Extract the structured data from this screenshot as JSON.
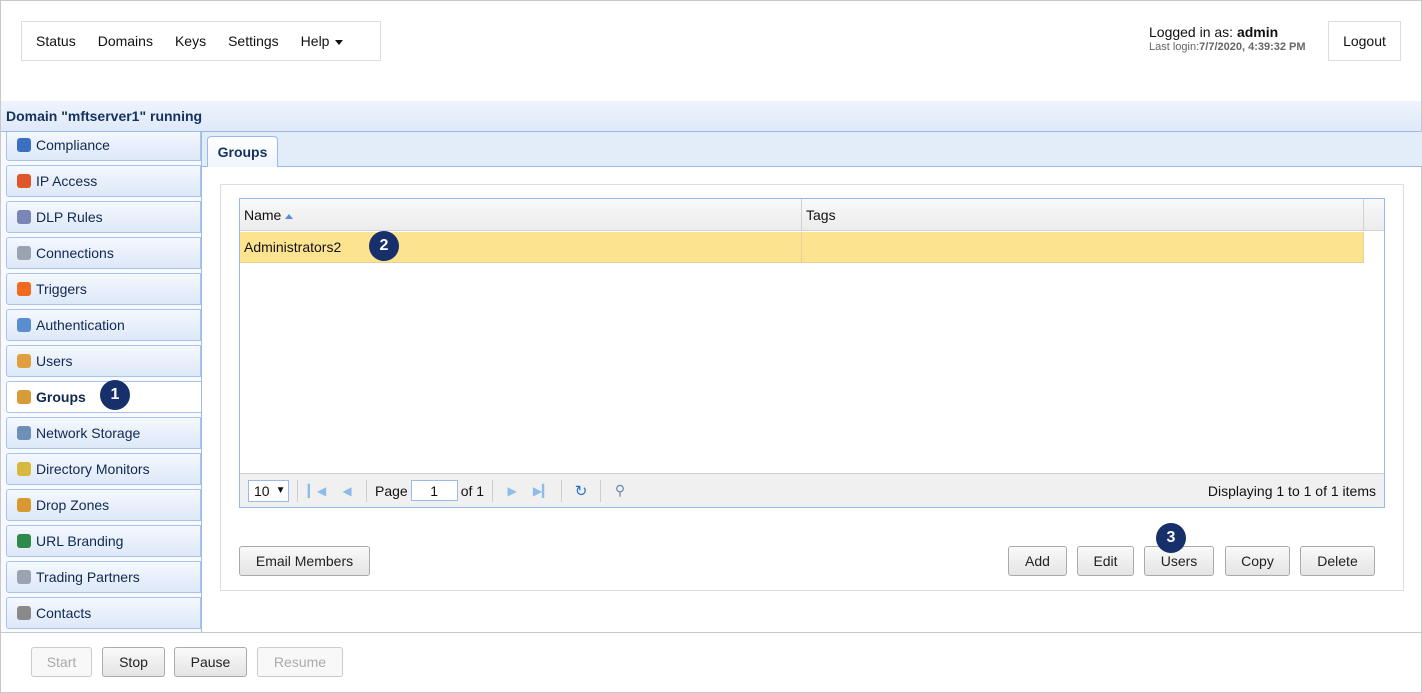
{
  "nav": {
    "items": [
      "Status",
      "Domains",
      "Keys",
      "Settings",
      "Help"
    ]
  },
  "user": {
    "logged_in_label": "Logged in as: ",
    "username": "admin",
    "last_login_label": "Last login:",
    "last_login": "7/7/2020, 4:39:32 PM",
    "logout": "Logout"
  },
  "domain_title": "Domain \"mftserver1\" running",
  "sidebar": {
    "items": [
      {
        "label": "Compliance",
        "color": "#3b6fc4"
      },
      {
        "label": "IP Access",
        "color": "#e0552a"
      },
      {
        "label": "DLP Rules",
        "color": "#7a86b8"
      },
      {
        "label": "Connections",
        "color": "#9aa4b0"
      },
      {
        "label": "Triggers",
        "color": "#f06a20"
      },
      {
        "label": "Authentication",
        "color": "#5a8ed0"
      },
      {
        "label": "Users",
        "color": "#e0a040"
      },
      {
        "label": "Groups",
        "color": "#d99a3a"
      },
      {
        "label": "Network Storage",
        "color": "#6d8fb8"
      },
      {
        "label": "Directory Monitors",
        "color": "#d8b840"
      },
      {
        "label": "Drop Zones",
        "color": "#d89a30"
      },
      {
        "label": "URL Branding",
        "color": "#2e8a4a"
      },
      {
        "label": "Trading Partners",
        "color": "#9aa4b0"
      },
      {
        "label": "Contacts",
        "color": "#8a8a8a"
      }
    ],
    "active": "Groups"
  },
  "tab": "Groups",
  "grid": {
    "columns": [
      "Name",
      "Tags"
    ],
    "rows": [
      {
        "name": "Administrators2",
        "tags": ""
      }
    ]
  },
  "pager": {
    "page_size": "10",
    "page_label": "Page",
    "page": "1",
    "of_label": "of 1",
    "display": "Displaying 1 to 1 of 1 items"
  },
  "actions": {
    "email": "Email Members",
    "add": "Add",
    "edit": "Edit",
    "users": "Users",
    "copy": "Copy",
    "delete": "Delete"
  },
  "bottom": {
    "start": "Start",
    "stop": "Stop",
    "pause": "Pause",
    "resume": "Resume"
  },
  "badges": [
    "1",
    "2",
    "3"
  ]
}
